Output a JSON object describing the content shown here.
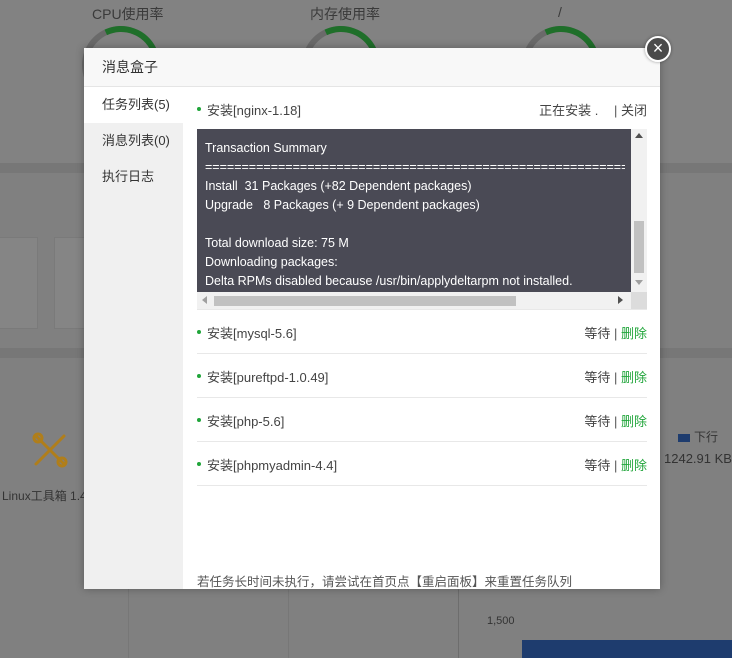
{
  "background": {
    "gauges": [
      {
        "label": "CPU使用率"
      },
      {
        "label": "内存使用率"
      },
      {
        "label": "/"
      }
    ],
    "tool_label": "Linux工具箱 1.4",
    "legend_label": "下行",
    "download_value": "1242.91 KB",
    "axis_tick": "1,500"
  },
  "modal": {
    "title": "消息盒子",
    "close_glyph": "×",
    "sidebar": [
      {
        "label": "任务列表(5)",
        "active": true
      },
      {
        "label": "消息列表(0)",
        "active": false
      },
      {
        "label": "执行日志",
        "active": false
      }
    ],
    "current_task": {
      "name": "安装[nginx-1.18]",
      "status": "正在安装 .",
      "separator": "|",
      "action": "关闭"
    },
    "terminal_text": "Transaction Summary\n=====================================================================================\nInstall  31 Packages (+82 Dependent packages)\nUpgrade   8 Packages (+ 9 Dependent packages)\n\nTotal download size: 75 M\nDownloading packages:\nDelta RPMs disabled because /usr/bin/applydeltarpm not installed.",
    "queued_tasks": [
      {
        "name": "安装[mysql-5.6]",
        "status": "等待",
        "separator": "|",
        "action": "删除"
      },
      {
        "name": "安装[pureftpd-1.0.49]",
        "status": "等待",
        "separator": "|",
        "action": "删除"
      },
      {
        "name": "安装[php-5.6]",
        "status": "等待",
        "separator": "|",
        "action": "删除"
      },
      {
        "name": "安装[phpmyadmin-4.4]",
        "status": "等待",
        "separator": "|",
        "action": "删除"
      }
    ],
    "footer_tip": "若任务长时间未执行，请尝试在首页点【重启面板】来重置任务队列"
  },
  "colors": {
    "accent_green": "#20a53a",
    "terminal_bg": "#4a4a55",
    "chart_blue": "#1e3c6e"
  }
}
